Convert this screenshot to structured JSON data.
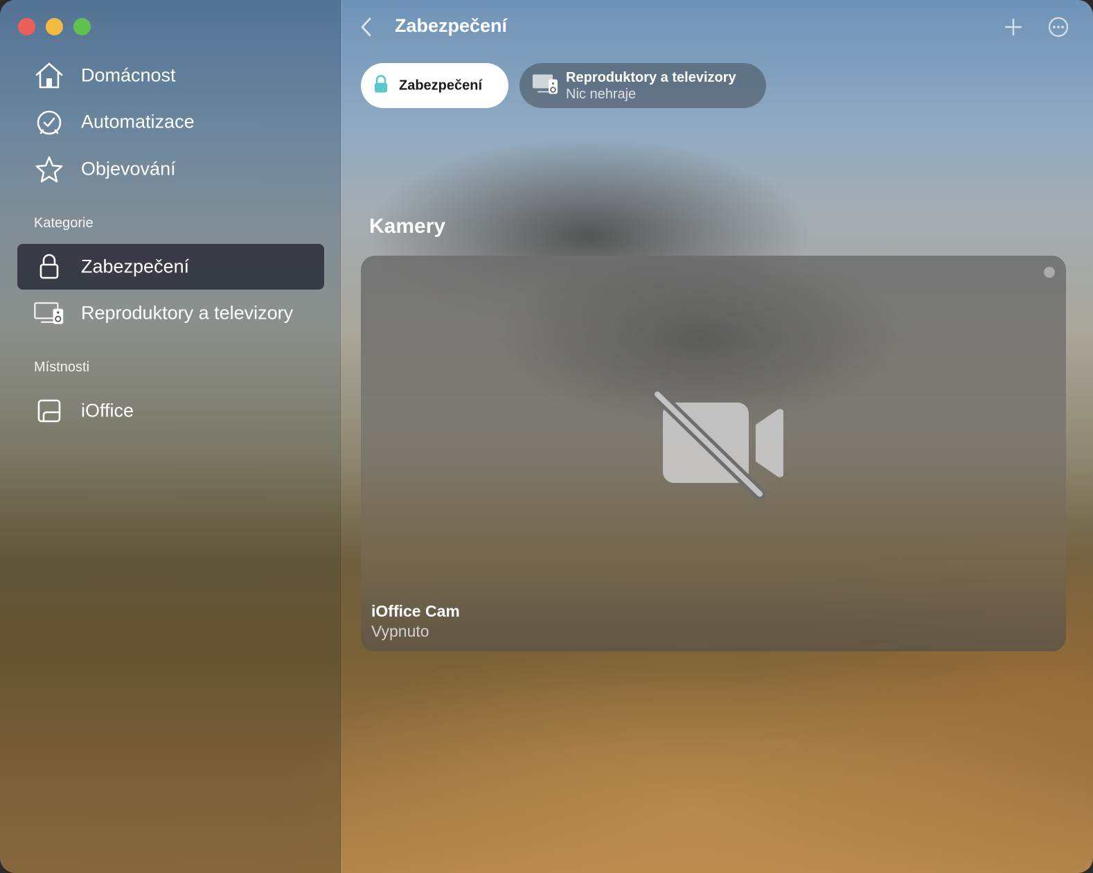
{
  "window": {
    "controls": [
      "close",
      "minimize",
      "zoom"
    ]
  },
  "sidebar": {
    "main_items": [
      {
        "label": "Domácnost",
        "icon": "house-icon"
      },
      {
        "label": "Automatizace",
        "icon": "clock-check-icon"
      },
      {
        "label": "Objevování",
        "icon": "star-icon"
      }
    ],
    "categories_heading": "Kategorie",
    "categories": [
      {
        "label": "Zabezpečení",
        "icon": "lock-icon",
        "selected": true
      },
      {
        "label": "Reproduktory a televizory",
        "icon": "tv-speaker-icon",
        "selected": false
      }
    ],
    "rooms_heading": "Místnosti",
    "rooms": [
      {
        "label": "iOffice",
        "icon": "room-icon"
      }
    ]
  },
  "header": {
    "title": "Zabezpečení"
  },
  "filter_pills": [
    {
      "label": "Zabezpečení",
      "active": true,
      "icon": "lock-icon",
      "icon_color": "#5ac8c8"
    },
    {
      "label": "Reproduktory a televizory",
      "sublabel": "Nic nehraje",
      "active": false,
      "icon": "tv-speaker-icon"
    }
  ],
  "cameras_section": {
    "title": "Kamery",
    "cameras": [
      {
        "name": "iOffice Cam",
        "status": "Vypnuto",
        "icon": "video-off-icon"
      }
    ]
  }
}
